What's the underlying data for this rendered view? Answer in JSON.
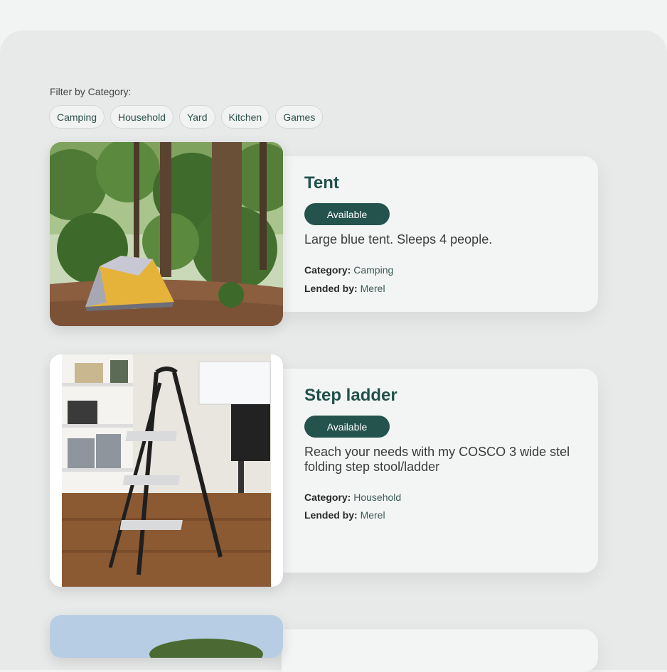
{
  "filter": {
    "label": "Filter by Category:",
    "chips": [
      "Camping",
      "Household",
      "Yard",
      "Kitchen",
      "Games"
    ]
  },
  "items": [
    {
      "title": "Tent",
      "status": "Available",
      "description": "Large blue tent. Sleeps 4 people.",
      "category_label": "Category:",
      "category": "Camping",
      "lender_label": "Lended by:",
      "lender": "Merel"
    },
    {
      "title": "Step ladder",
      "status": "Available",
      "description": "Reach your needs with my COSCO 3 wide stel folding step stool/ladder",
      "category_label": "Category:",
      "category": "Household",
      "lender_label": "Lended by:",
      "lender": "Merel"
    }
  ],
  "colors": {
    "accent": "#24524d",
    "title": "#22514c",
    "card": "#f3f5f4",
    "panel": "#e8eaea"
  }
}
